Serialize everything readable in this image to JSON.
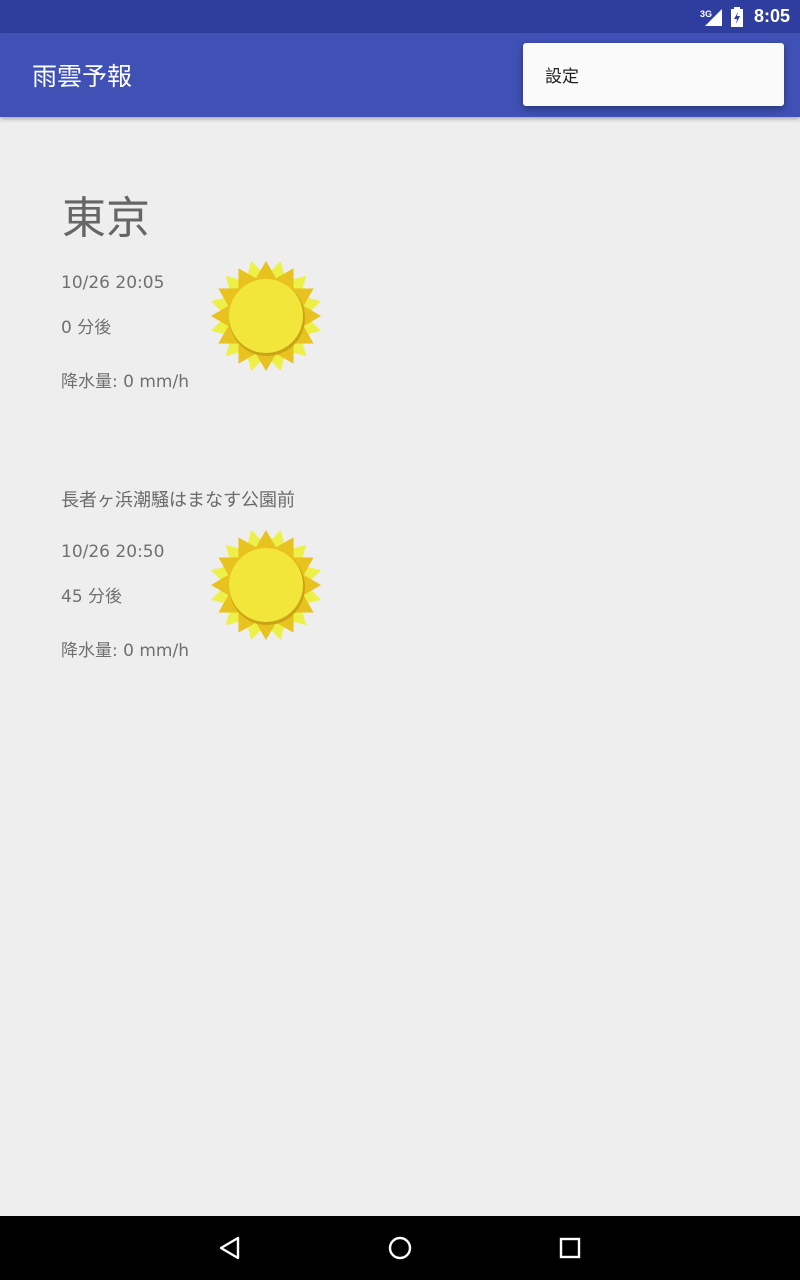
{
  "status_bar": {
    "network": "3G",
    "time": "8:05"
  },
  "app_bar": {
    "title": "雨雲予報"
  },
  "menu": {
    "items": [
      "設定"
    ]
  },
  "forecasts": [
    {
      "location": "東京",
      "datetime": "10/26 20:05",
      "offset": "0 分後",
      "precipitation": "降水量: 0 mm/h",
      "icon": "sun-icon"
    },
    {
      "location": "長者ヶ浜潮騒はまなす公園前",
      "datetime": "10/26 20:50",
      "offset": "45 分後",
      "precipitation": "降水量: 0 mm/h",
      "icon": "sun-icon"
    }
  ],
  "nav_bar": {
    "buttons": [
      "back-icon",
      "home-icon",
      "recents-icon"
    ]
  },
  "colors": {
    "status_bar": "#2f3e9e",
    "app_bar": "#3f51b5",
    "background": "#eeeeee",
    "text_secondary": "#707070",
    "sun_outer": "#e8c21f",
    "sun_inner": "#f2e63a"
  }
}
